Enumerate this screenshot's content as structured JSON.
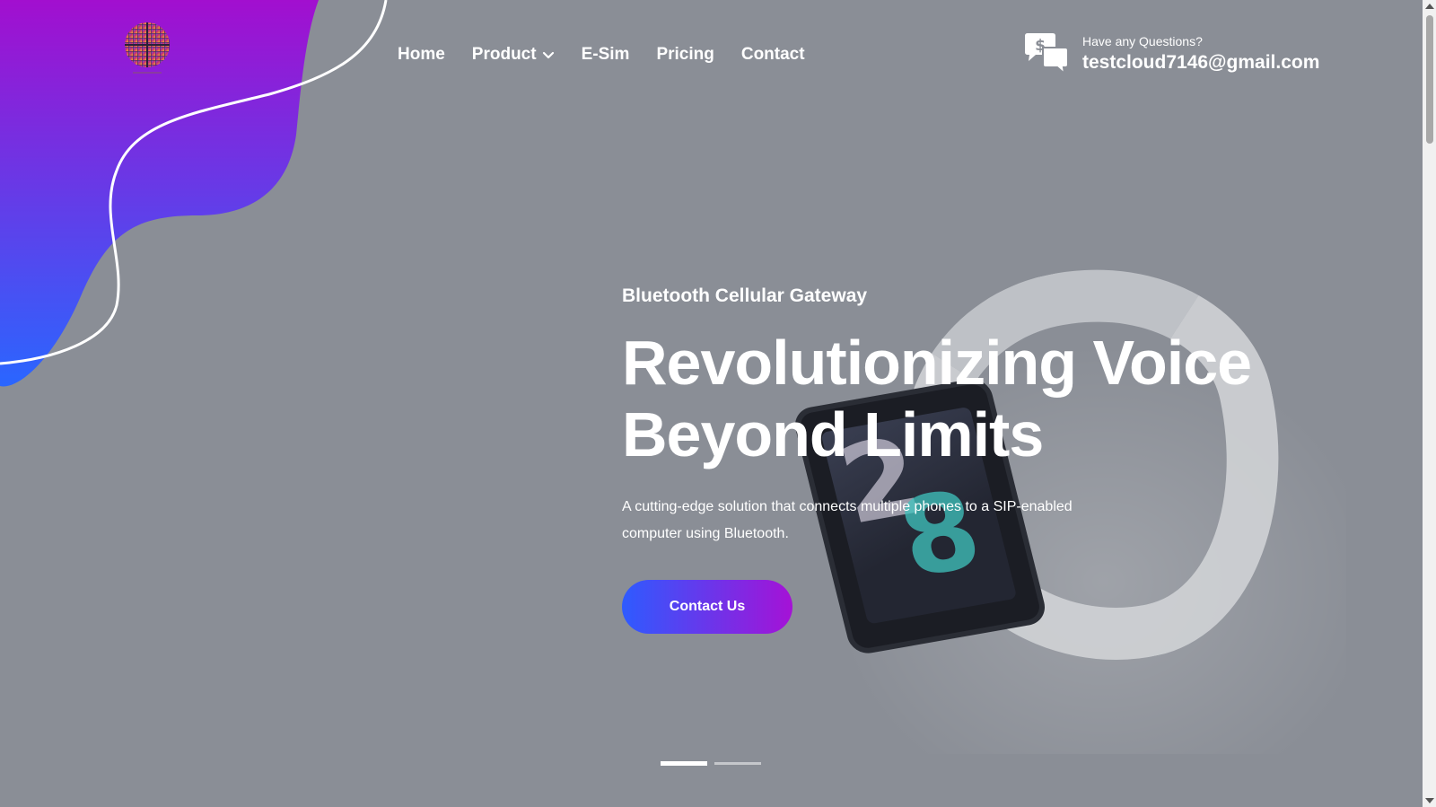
{
  "colors": {
    "page_background": "#8a8e96",
    "blob_gradient_top": "#a20fcf",
    "blob_gradient_bottom": "#2a66ff",
    "cta_gradient_start": "#2e5bff",
    "cta_gradient_end": "#a512d6"
  },
  "header": {
    "logo_icon": "globe-grid-logo",
    "nav": [
      {
        "label": "Home"
      },
      {
        "label": "Product",
        "icon": "chevron-down-icon"
      },
      {
        "label": "E-Sim"
      },
      {
        "label": "Pricing"
      },
      {
        "label": "Contact"
      }
    ],
    "contact": {
      "icon": "chat-dollar-icon",
      "question": "Have any Questions?",
      "email": "testcloud7146@gmail.com"
    }
  },
  "hero": {
    "eyebrow": "Bluetooth Cellular Gateway",
    "title_line1": "Revolutionizing Voice",
    "title_line2": "Beyond Limits",
    "description": "A cutting-edge solution that connects multiple phones to a SIP-enabled computer using Bluetooth.",
    "cta_label": "Contact Us",
    "image": "smartwatch-band-photo"
  },
  "slider": {
    "slides": 2,
    "active_index": 0
  },
  "scrollbar": {
    "icons": [
      "scroll-up-icon",
      "scroll-down-icon"
    ]
  }
}
